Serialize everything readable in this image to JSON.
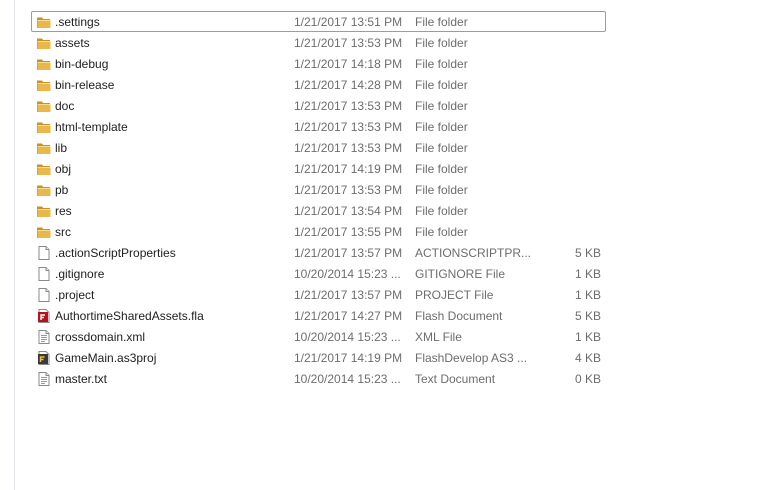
{
  "files": [
    {
      "name": ".settings",
      "date": "1/21/2017 13:51 PM",
      "type": "File folder",
      "size": "",
      "icon": "folder-icon",
      "focused": true
    },
    {
      "name": "assets",
      "date": "1/21/2017 13:53 PM",
      "type": "File folder",
      "size": "",
      "icon": "folder-icon"
    },
    {
      "name": "bin-debug",
      "date": "1/21/2017 14:18 PM",
      "type": "File folder",
      "size": "",
      "icon": "folder-icon"
    },
    {
      "name": "bin-release",
      "date": "1/21/2017 14:28 PM",
      "type": "File folder",
      "size": "",
      "icon": "folder-icon"
    },
    {
      "name": "doc",
      "date": "1/21/2017 13:53 PM",
      "type": "File folder",
      "size": "",
      "icon": "folder-icon"
    },
    {
      "name": "html-template",
      "date": "1/21/2017 13:53 PM",
      "type": "File folder",
      "size": "",
      "icon": "folder-icon"
    },
    {
      "name": "lib",
      "date": "1/21/2017 13:53 PM",
      "type": "File folder",
      "size": "",
      "icon": "folder-icon"
    },
    {
      "name": "obj",
      "date": "1/21/2017 14:19 PM",
      "type": "File folder",
      "size": "",
      "icon": "folder-icon"
    },
    {
      "name": "pb",
      "date": "1/21/2017 13:53 PM",
      "type": "File folder",
      "size": "",
      "icon": "folder-icon"
    },
    {
      "name": "res",
      "date": "1/21/2017 13:54 PM",
      "type": "File folder",
      "size": "",
      "icon": "folder-icon"
    },
    {
      "name": "src",
      "date": "1/21/2017 13:55 PM",
      "type": "File folder",
      "size": "",
      "icon": "folder-icon"
    },
    {
      "name": ".actionScriptProperties",
      "date": "1/21/2017 13:57 PM",
      "type": "ACTIONSCRIPTPR...",
      "size": "5 KB",
      "icon": "file-icon"
    },
    {
      "name": ".gitignore",
      "date": "10/20/2014 15:23 ...",
      "type": "GITIGNORE File",
      "size": "1 KB",
      "icon": "file-icon"
    },
    {
      "name": ".project",
      "date": "1/21/2017 13:57 PM",
      "type": "PROJECT File",
      "size": "1 KB",
      "icon": "file-icon"
    },
    {
      "name": "AuthortimeSharedAssets.fla",
      "date": "1/21/2017 14:27 PM",
      "type": "Flash Document",
      "size": "5 KB",
      "icon": "flash-document-icon"
    },
    {
      "name": "crossdomain.xml",
      "date": "10/20/2014 15:23 ...",
      "type": "XML File",
      "size": "1 KB",
      "icon": "text-file-icon"
    },
    {
      "name": "GameMain.as3proj",
      "date": "1/21/2017 14:19 PM",
      "type": "FlashDevelop AS3 ...",
      "size": "4 KB",
      "icon": "flashdevelop-project-icon"
    },
    {
      "name": "master.txt",
      "date": "10/20/2014 15:23 ...",
      "type": "Text Document",
      "size": "0 KB",
      "icon": "text-file-icon"
    }
  ],
  "colors": {
    "folder": "#e8b84a",
    "folder_dark": "#c8912a",
    "focus_border": "#7da2ce",
    "secondary_text": "#6d6d6d",
    "flash_red": "#b3141b"
  }
}
